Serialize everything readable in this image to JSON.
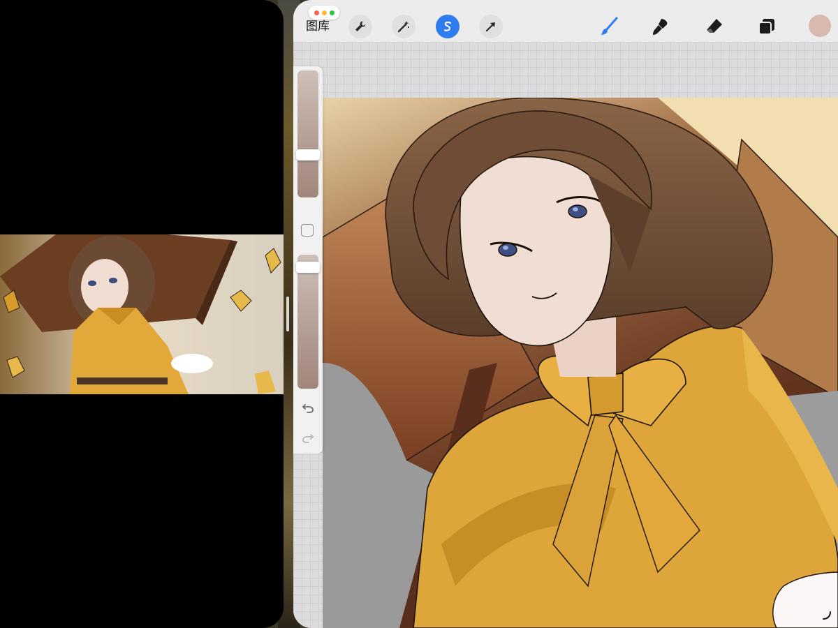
{
  "left_window": {
    "description_icon": "image-viewer"
  },
  "procreate": {
    "toolbar": {
      "gallery_label": "图库",
      "tools_left": [
        {
          "icon": "wrench-icon",
          "active": false
        },
        {
          "icon": "magic-wand-icon",
          "active": false
        },
        {
          "icon": "selection-s-icon",
          "active": true
        },
        {
          "icon": "transform-arrow-icon",
          "active": false
        }
      ],
      "tools_right": [
        {
          "icon": "brush-icon",
          "active": true
        },
        {
          "icon": "smudge-icon",
          "active": false
        },
        {
          "icon": "eraser-icon",
          "active": false
        },
        {
          "icon": "layers-icon",
          "active": false
        }
      ]
    },
    "sidebar": {
      "brush_size_level": 0.75,
      "opacity_level": 1.0
    },
    "colors": {
      "active_color": "#d7b9ae",
      "selection_accent": "#2f7cf0",
      "brush_accent": "#2f7cf0",
      "dot_red": "#ff5f57",
      "dot_yellow": "#febc2e",
      "dot_green": "#28c840"
    }
  }
}
